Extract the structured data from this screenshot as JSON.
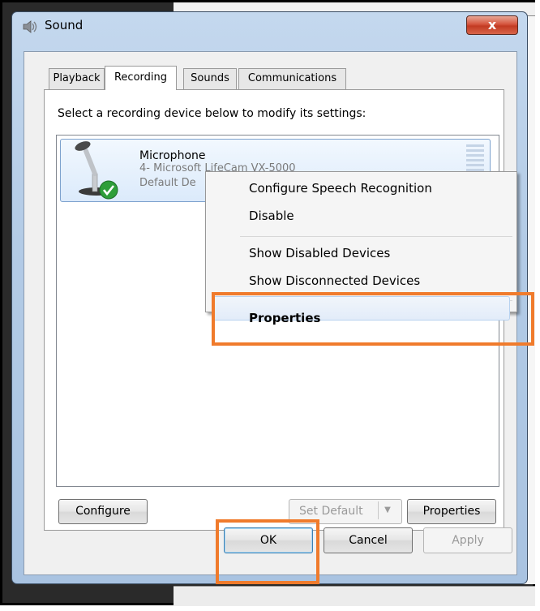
{
  "window": {
    "title": "Sound",
    "close_glyph": "x"
  },
  "tabs": [
    {
      "label": "Playback",
      "active": false
    },
    {
      "label": "Recording",
      "active": true
    },
    {
      "label": "Sounds",
      "active": false
    },
    {
      "label": "Communications",
      "active": false
    }
  ],
  "recording": {
    "instruction": "Select a recording device below to modify its settings:",
    "devices": [
      {
        "name": "Microphone",
        "description": "4- Microsoft LifeCam VX-5000",
        "status": "Default De",
        "icon": "microphone-icon",
        "default_badge_icon": "checkmark-icon"
      }
    ]
  },
  "context_menu": {
    "items": [
      {
        "label": "Configure Speech Recognition",
        "bold": false
      },
      {
        "label": "Disable",
        "bold": false
      },
      {
        "label": "Show Disabled Devices",
        "bold": false
      },
      {
        "label": "Show Disconnected Devices",
        "bold": false
      },
      {
        "label": "Properties",
        "bold": true
      }
    ]
  },
  "panel_buttons": {
    "configure": "Configure",
    "set_default": "Set Default",
    "set_default_arrow": "▼",
    "properties": "Properties"
  },
  "dialog_buttons": {
    "ok": "OK",
    "cancel": "Cancel",
    "apply": "Apply"
  },
  "colors": {
    "highlight": "#f07b2c",
    "selection": "#dbeafb",
    "close_button": "#c23a22"
  }
}
